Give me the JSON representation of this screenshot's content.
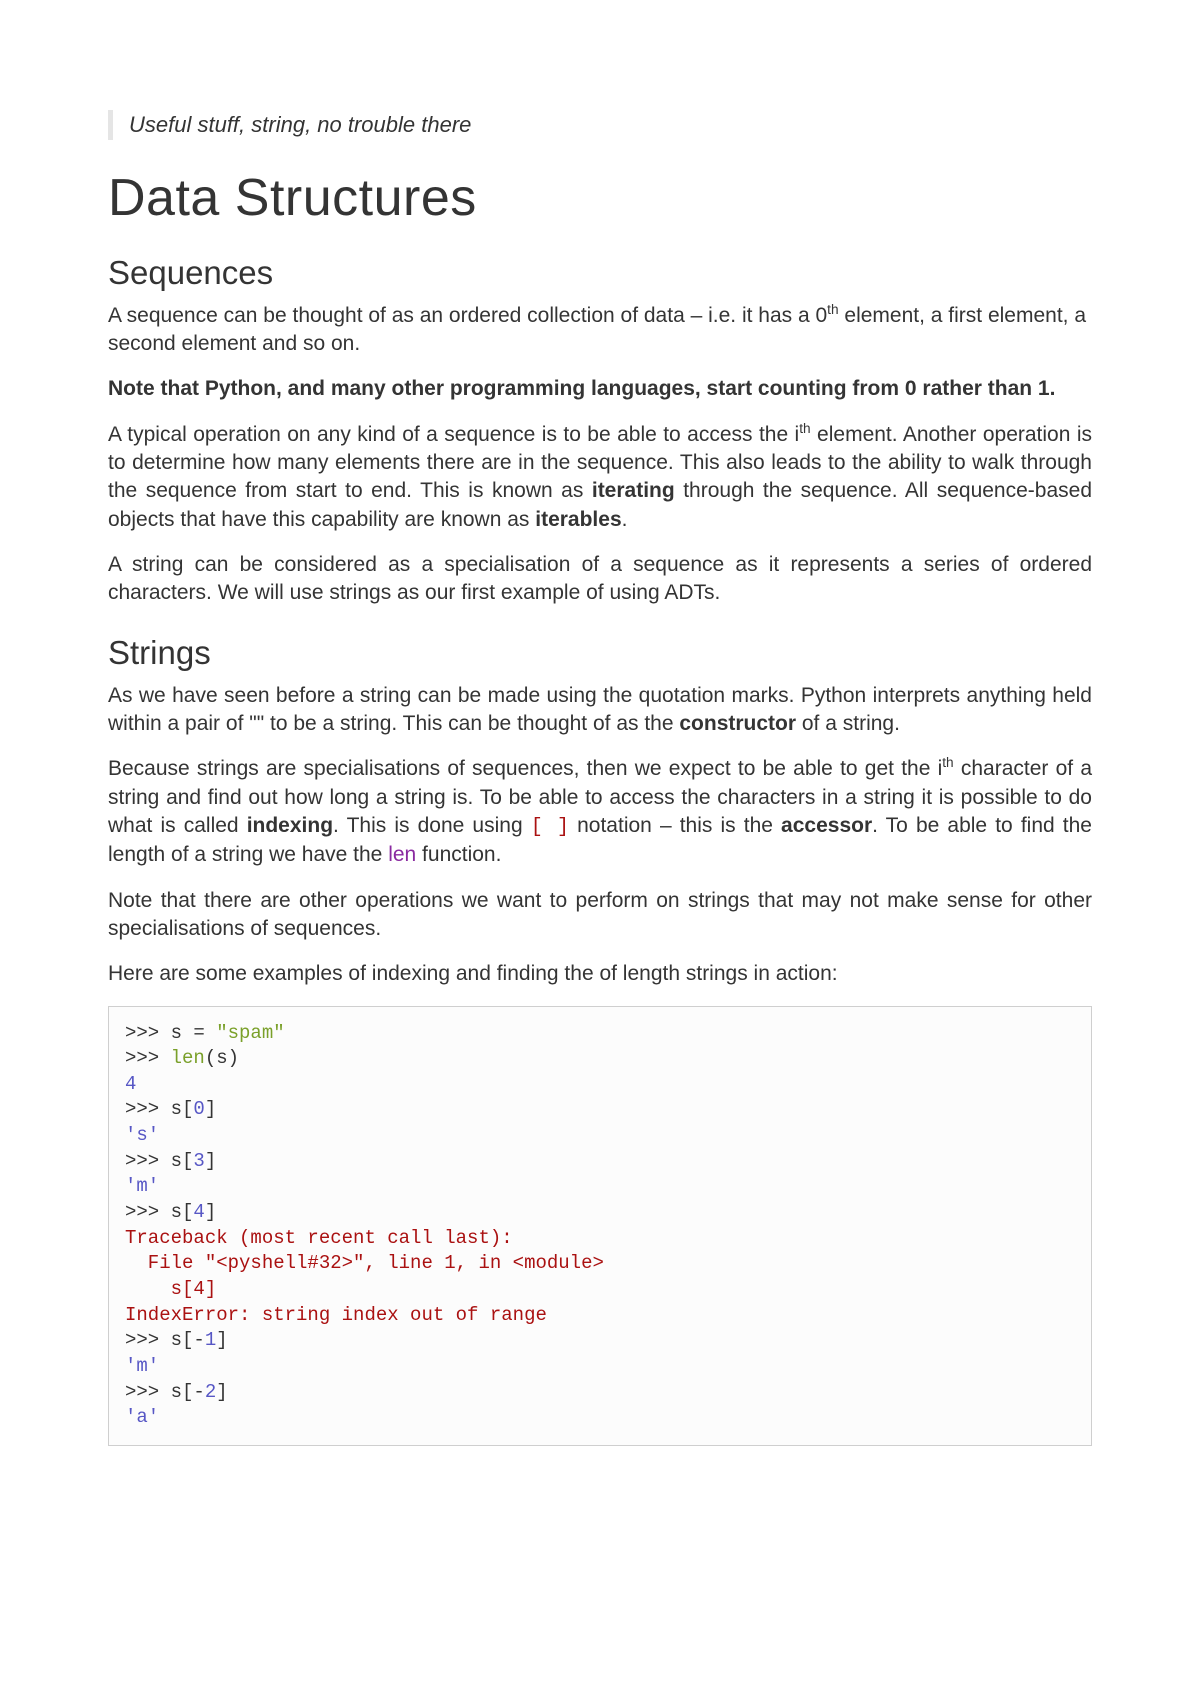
{
  "quote": "Useful stuff, string, no trouble there",
  "title": "Data Structures",
  "section1": {
    "heading": "Sequences",
    "p1a": "A sequence can be thought of as an ordered collection of data – i.e. it has a 0",
    "p1b": " element, a first element, a second element and so on.",
    "note": "Note that Python, and many other programming languages, start counting from 0 rather than 1.",
    "p2a": "A typical operation on any kind of a sequence is to be able to access the i",
    "p2b": " element. Another operation is to determine how many elements there are in the sequence. This also leads to the ability to walk through the sequence from start to end. This is known as ",
    "p2c": "iterating",
    "p2d": " through the sequence. All sequence-based objects that have this capability are known as ",
    "p2e": "iterables",
    "p2f": ".",
    "p3": "A string can be considered as a specialisation of a sequence as it represents a series of ordered characters. We will use strings as our first example of using ADTs."
  },
  "section2": {
    "heading": "Strings",
    "p1a": "As we have seen before a string can be made using the quotation marks. Python interprets anything held within a pair of \"\" to be a string. This can be thought of as the ",
    "p1b": "constructor",
    "p1c": " of a string.",
    "p2a": "Because strings are specialisations of sequences, then we expect to be able to get the i",
    "p2b": " character of a string and find out how long a string is. To be able to access the characters in a string it is possible to do what is called ",
    "p2c": "indexing",
    "p2d": ". This is done using ",
    "p2code": "[ ]",
    "p2e": " notation – this is the ",
    "p2f": "accessor",
    "p2g": ". To be able to find the length of a string we have the ",
    "p2fn": "len",
    "p2h": " function.",
    "p3": "Note that there are other operations we want to perform on strings that may not make sense for other specialisations of sequences.",
    "p4": "Here are some examples of indexing and finding the of length strings in action:"
  },
  "code": {
    "l1a": ">>> ",
    "l1b": "s = ",
    "l1c": "\"spam\"",
    "l2a": ">>> ",
    "l2b": "len",
    "l2c": "(s)",
    "l3": "4",
    "l4a": ">>> ",
    "l4b": "s[",
    "l4c": "0",
    "l4d": "]",
    "l5": "'s'",
    "l6a": ">>> ",
    "l6b": "s[",
    "l6c": "3",
    "l6d": "]",
    "l7": "'m'",
    "l8a": ">>> ",
    "l8b": "s[",
    "l8c": "4",
    "l8d": "]",
    "l9": "Traceback (most recent call last):",
    "l10": "  File \"<pyshell#32>\", line 1, in <module>",
    "l11": "    s[4]",
    "l12": "IndexError: string index out of range",
    "l13a": ">>> ",
    "l13b": "s[-",
    "l13c": "1",
    "l13d": "]",
    "l14": "'m'",
    "l15a": ">>> ",
    "l15b": "s[-",
    "l15c": "2",
    "l15d": "]",
    "l16": "'a'"
  },
  "sup_th": "th"
}
